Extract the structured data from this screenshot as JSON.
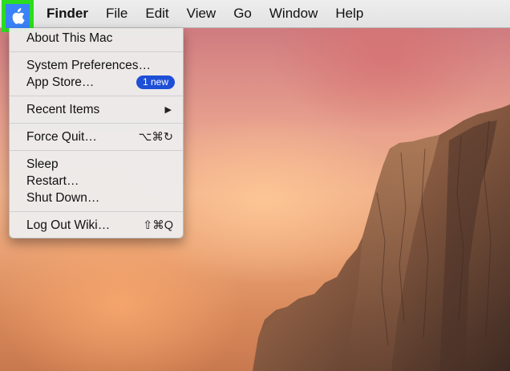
{
  "menubar": {
    "app_name": "Finder",
    "items": [
      "File",
      "Edit",
      "View",
      "Go",
      "Window",
      "Help"
    ],
    "apple_highlight_color": "#2bdc1f"
  },
  "apple_menu": {
    "about": "About This Mac",
    "system_preferences": "System Preferences…",
    "app_store": "App Store…",
    "app_store_badge": "1 new",
    "recent_items": "Recent Items",
    "recent_items_indicator": "▶",
    "force_quit": "Force Quit…",
    "force_quit_shortcut": "⌥⌘↻",
    "sleep": "Sleep",
    "restart": "Restart…",
    "shut_down": "Shut Down…",
    "log_out": "Log Out Wiki…",
    "log_out_shortcut": "⇧⌘Q"
  },
  "icons": {
    "apple": "apple-icon",
    "submenu": "chevron-right-icon"
  }
}
